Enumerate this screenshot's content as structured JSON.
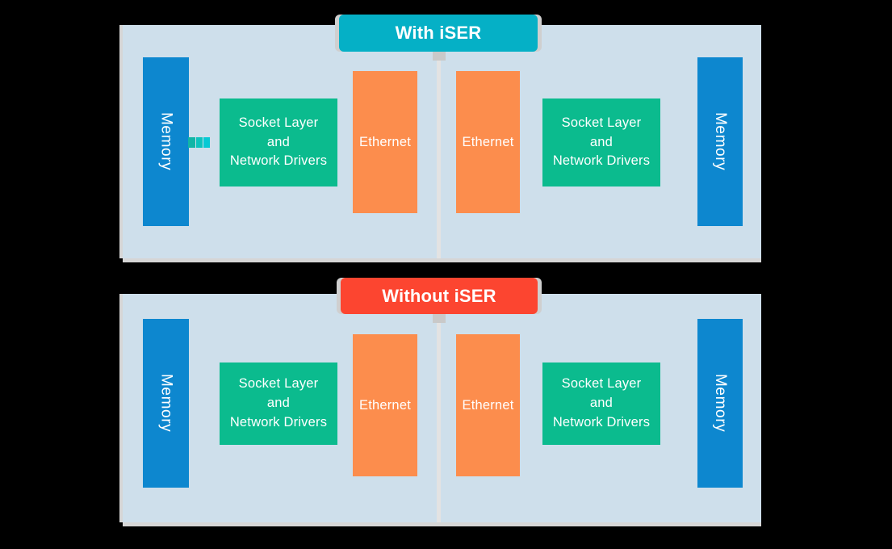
{
  "diagram": {
    "title_visible": false,
    "colors": {
      "panel_background": "#cedfeb",
      "memory_blue": "#0d87cf",
      "sockets_green": "#0bbb8e",
      "ethernet_orange": "#fc8d4d",
      "with_iser_teal": "#05b0c6",
      "without_iser_red": "#fc4530",
      "divider_gray": "#e3e3e3",
      "page_background": "#000000"
    },
    "panels": [
      {
        "id": "with-iser",
        "banner_label": "With iSER",
        "banner_color": "#05b0c6",
        "has_connector": true,
        "left_side": {
          "memory_label": "Memory",
          "sockets_label": "Socket Layer and\nNetwork Drivers",
          "sockets_line1": "Socket Layer and",
          "sockets_line2": "Network Drivers",
          "ethernet_label": "Ethernet"
        },
        "right_side": {
          "memory_label": "Memory",
          "sockets_line1": "Socket Layer and",
          "sockets_line2": "Network Drivers",
          "ethernet_label": "Ethernet"
        }
      },
      {
        "id": "without-iser",
        "banner_label": "Without iSER",
        "banner_color": "#fc4530",
        "has_connector": false,
        "left_side": {
          "memory_label": "Memory",
          "sockets_line1": "Socket Layer and",
          "sockets_line2": "Network Drivers",
          "ethernet_label": "Ethernet"
        },
        "right_side": {
          "memory_label": "Memory",
          "sockets_line1": "Socket Layer and",
          "sockets_line2": "Network Drivers",
          "ethernet_label": "Ethernet"
        }
      }
    ]
  }
}
